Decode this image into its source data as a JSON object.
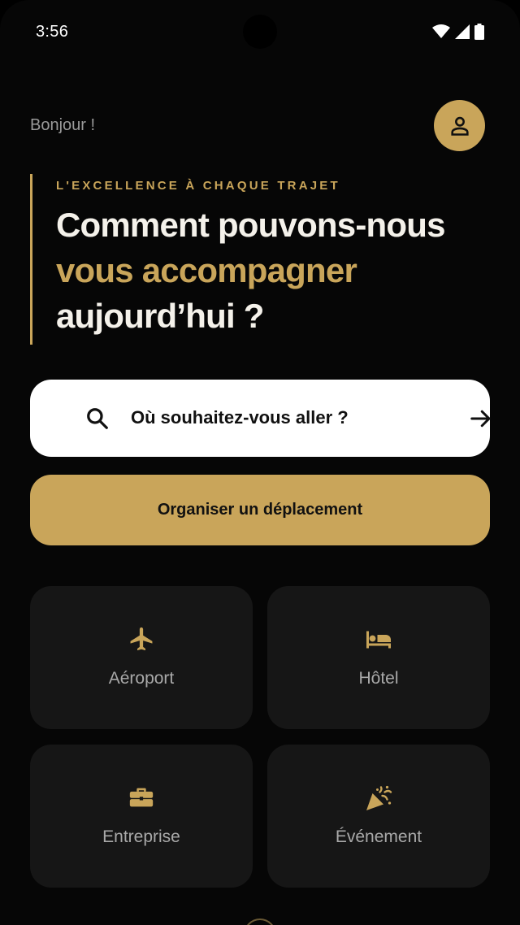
{
  "status_bar": {
    "time": "3:56",
    "icons": [
      "wifi-icon",
      "signal-icon",
      "battery-icon"
    ]
  },
  "header": {
    "greeting": "Bonjour !",
    "avatar_icon": "person-icon"
  },
  "hero": {
    "tagline": "L'EXCELLENCE À CHAQUE TRAJET",
    "line1": "Comment pouvons-nous",
    "line2": "vous accompagner",
    "line3": "aujourd’hui ?"
  },
  "search": {
    "placeholder": "Où souhaitez-vous aller ?",
    "icon": "search-icon",
    "action_icon": "arrow-right-icon"
  },
  "primary_action": {
    "label": "Organiser un déplacement"
  },
  "categories": [
    {
      "label": "Aéroport",
      "icon": "airplane-icon"
    },
    {
      "label": "Hôtel",
      "icon": "bed-icon"
    },
    {
      "label": "Entreprise",
      "icon": "briefcase-icon"
    },
    {
      "label": "Événement",
      "icon": "party-popper-icon"
    }
  ],
  "colors": {
    "accent": "#c9a55a",
    "background": "#060606",
    "tile": "#161616",
    "headline": "#f4f1ea"
  }
}
